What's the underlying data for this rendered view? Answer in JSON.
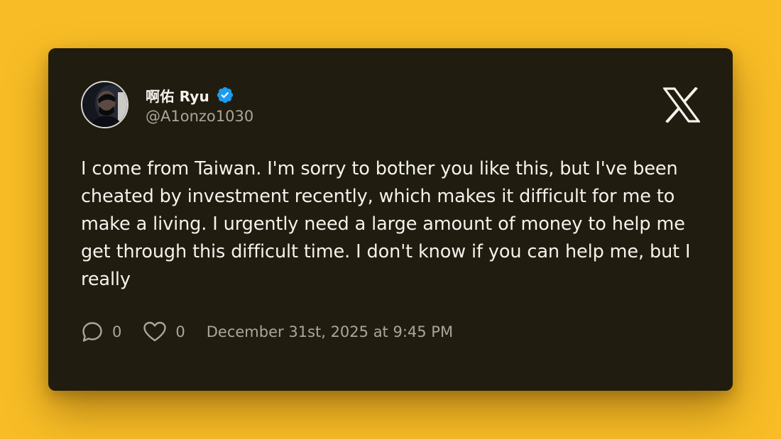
{
  "author": {
    "display_name": "啊佑 Ryu",
    "handle": "@A1onzo1030",
    "verified_icon": "verified-badge-icon",
    "avatar_icon": "avatar"
  },
  "platform_icon": "x-logo-icon",
  "tweet": {
    "text": "I come from Taiwan. I'm sorry to bother you like this, but I've been cheated by investment recently, which makes it difficult for me to make a living. I urgently need a large amount of money to help me get through this difficult time. I don't know if you can help me, but I really"
  },
  "stats": {
    "replies": "0",
    "likes": "0",
    "reply_icon": "comment-icon",
    "like_icon": "heart-icon"
  },
  "timestamp": "December 31st, 2025 at 9:45 PM",
  "colors": {
    "background": "#f8bd26",
    "card": "#201c0f",
    "text": "#f4f2ec",
    "muted": "#a9a69c",
    "verified": "#1d9bf0"
  }
}
